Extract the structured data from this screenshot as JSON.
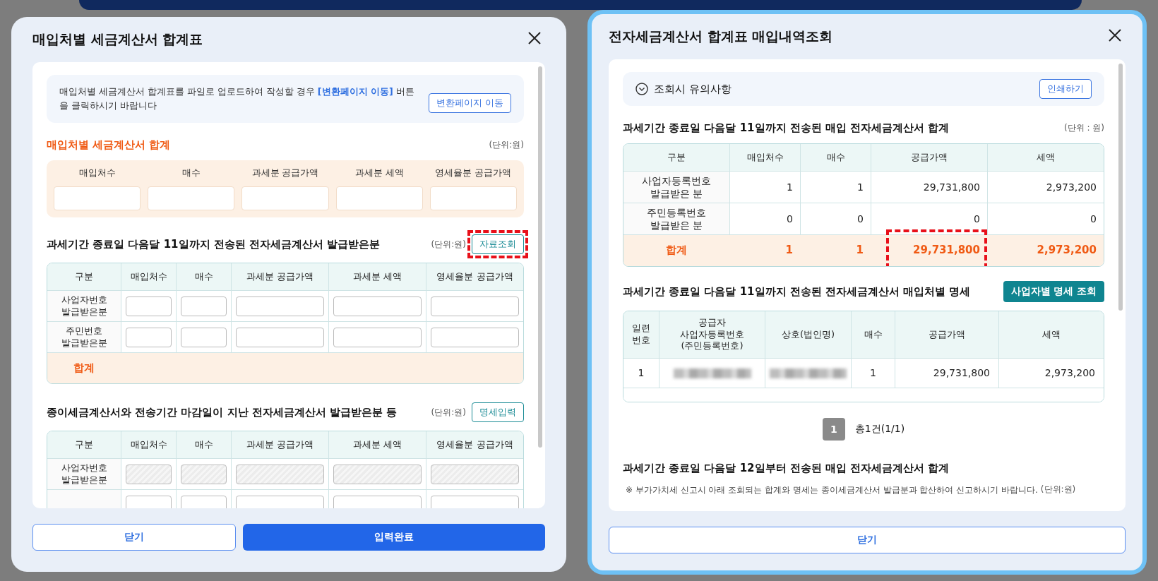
{
  "left_dialog": {
    "title": "매입처별 세금계산서 합계표",
    "notice": {
      "text": "매입처별 세금계산서 합계표를 파일로 업로드하여 작성할 경우 **[변환페이지 이동]** 버튼을 클릭하시기 바랍니다",
      "button": "변환페이지 이동"
    },
    "summary": {
      "title": "매입처별 세금계산서 합계",
      "unit": "(단위:원)",
      "fields": [
        "매입처수",
        "매수",
        "과세분 공급가액",
        "과세분 세액",
        "영세율분 공급가액"
      ]
    },
    "sections": [
      {
        "title": "과세기간 종료일 다음달 11일까지 전송된 전자세금계산서 발급받은분",
        "unit": "(단위:원)",
        "button": "자료조회",
        "highlighted": true,
        "columns": [
          "구분",
          "매입처수",
          "매수",
          "과세분 공급가액",
          "과세분 세액",
          "영세율분 공급가액"
        ],
        "rows": [
          {
            "label": "사업자번호\n발급받은분",
            "disabled": false
          },
          {
            "label": "주민번호\n발급받은분",
            "disabled": false
          }
        ],
        "total": "합계"
      },
      {
        "title": "종이세금계산서와 전송기간 마감일이 지난 전자세금계산서 발급받은분 등",
        "unit": "(단위:원)",
        "button": "명세입력",
        "highlighted": false,
        "columns": [
          "구분",
          "매입처수",
          "매수",
          "과세분 공급가액",
          "과세분 세액",
          "영세율분 공급가액"
        ],
        "rows": [
          {
            "label": "사업자번호\n발급받은분",
            "disabled": true
          },
          {
            "disabled": false
          }
        ]
      }
    ],
    "buttons": [
      {
        "label": "닫기",
        "kind": "secondary"
      },
      {
        "label": "입력완료",
        "kind": "primary"
      }
    ]
  },
  "right_dialog": {
    "title": "전자세금계산서 합계표 매입내역조회",
    "notice": {
      "label": "조회시 유의사항",
      "expanded": false,
      "button": "인쇄하기"
    },
    "summary_table": {
      "title": "과세기간 종료일 다음달 11일까지 전송된 매입 전자세금계산서 합계",
      "unit": "(단위 : 원)",
      "columns": [
        "구분",
        "매입처수",
        "매수",
        "공급가액",
        "세액"
      ],
      "rows": [
        {
          "cells": [
            {
              "text": "사업자등록번호\n발급받은 분"
            },
            {
              "text": "1"
            },
            {
              "text": "1"
            },
            {
              "text": "29,731,800"
            },
            {
              "text": "2,973,200"
            }
          ]
        },
        {
          "cells": [
            {
              "text": "주민등록번호\n발급받은 분"
            },
            {
              "text": "0"
            },
            {
              "text": "0"
            },
            {
              "text": "0"
            },
            {
              "text": "0"
            }
          ]
        }
      ],
      "total": {
        "cells": [
          {
            "text": "합계",
            "highlighted": false
          },
          {
            "text": "1",
            "highlighted": false
          },
          {
            "text": "1",
            "highlighted": false
          },
          {
            "text": "29,731,800",
            "highlighted": true
          },
          {
            "text": "2,973,200",
            "highlighted": false
          }
        ]
      }
    },
    "detail_table": {
      "title": "과세기간 종료일 다음달 11일까지 전송된 전자세금계산서 매입처별 명세",
      "button": "사업자별 명세 조회",
      "columns": [
        "일련\n번호",
        "공급자\n사업자등록번호\n(주민등록번호)",
        "상호(법인명)",
        "매수",
        "공급가액",
        "세액"
      ],
      "rows": [
        {
          "cells": [
            {
              "kind": "text",
              "text": "1"
            },
            {
              "kind": "redacted"
            },
            {
              "kind": "redacted"
            },
            {
              "kind": "text",
              "text": "1"
            },
            {
              "kind": "text",
              "text": "29,731,800"
            },
            {
              "kind": "text",
              "text": "2,973,200"
            }
          ]
        }
      ]
    },
    "pagination": {
      "pages": [
        {
          "label": "1",
          "selected": true
        }
      ],
      "summary": "총1건(1/1)"
    },
    "late_section": {
      "title": "과세기간 종료일 다음달 12일부터 전송된 매입 전자세금계산서 합계",
      "note": "※ 부가가치세 신고시 아래 조회되는 합계와 명세는 종이세금계산서 발급분과 합산하여 신고하시기 바랍니다.",
      "unit": "(단위:원)"
    },
    "buttons": [
      {
        "label": "닫기",
        "kind": "secondary"
      }
    ]
  }
}
